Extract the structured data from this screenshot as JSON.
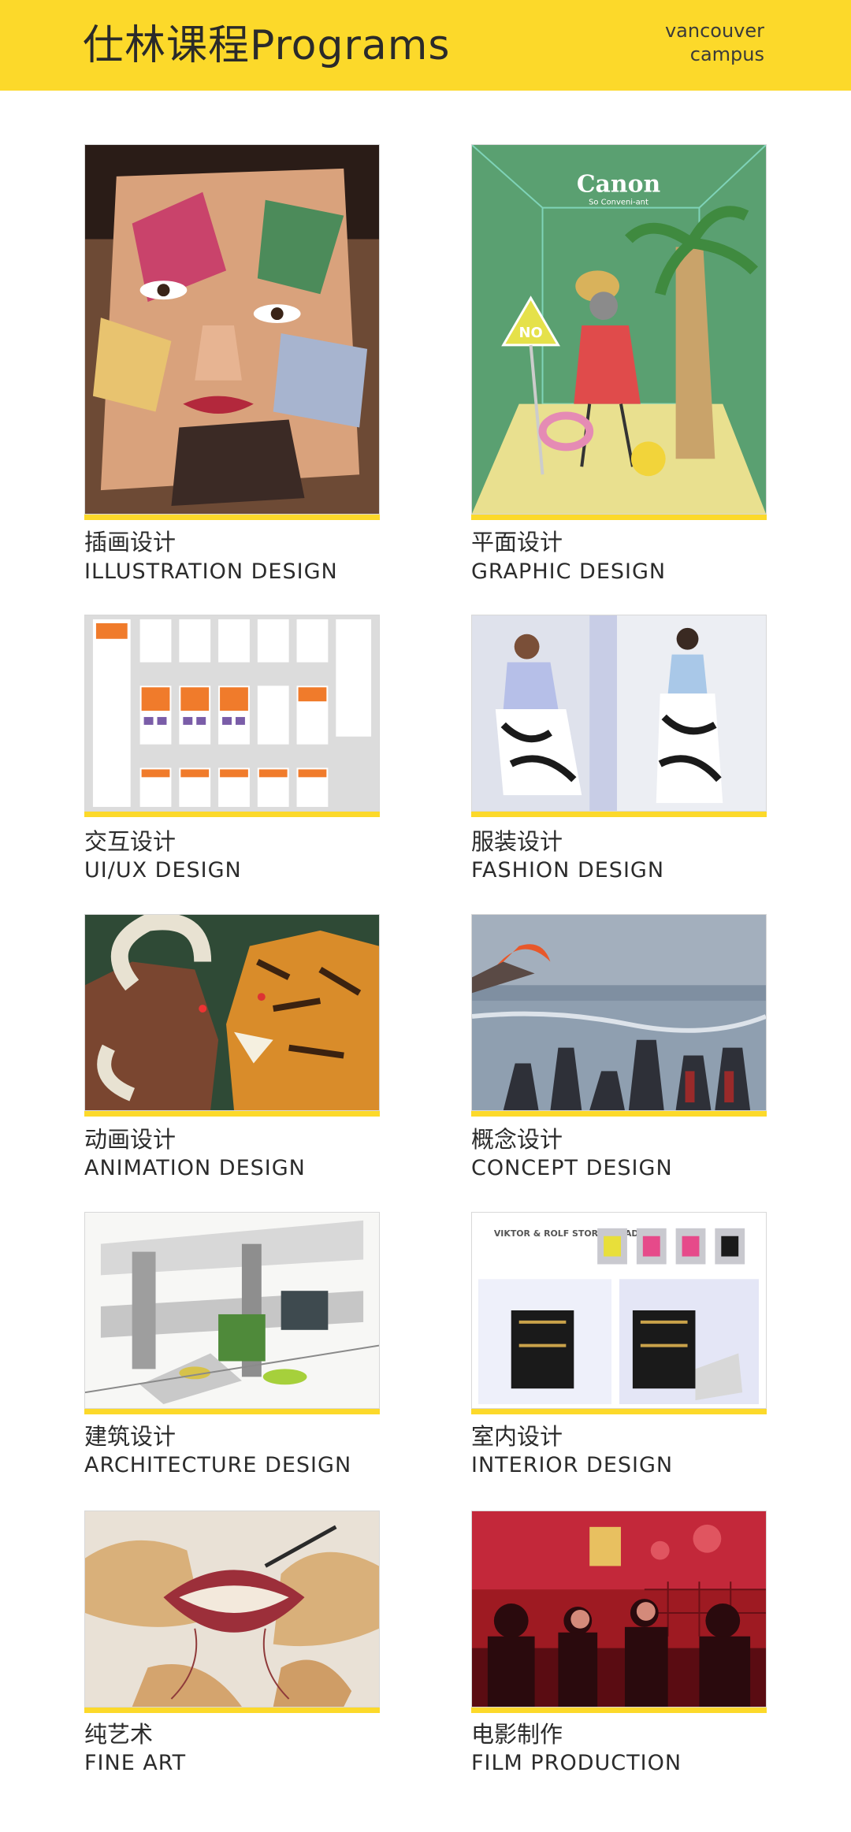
{
  "header": {
    "title": "仕林课程Programs",
    "campus_line1": "vancouver",
    "campus_line2": "campus",
    "accent_color": "#fcd92a"
  },
  "programs": [
    {
      "cn": "插画设计",
      "en": "ILLUSTRATION DESIGN",
      "image": "collage portrait of a face"
    },
    {
      "cn": "平面设计",
      "en": "GRAPHIC DESIGN",
      "image": "Canon poster illustration"
    },
    {
      "cn": "交互设计",
      "en": "UI/UX DESIGN",
      "image": "app wireframe flow"
    },
    {
      "cn": "服装设计",
      "en": "FASHION DESIGN",
      "image": "fashion model photos"
    },
    {
      "cn": "动画设计",
      "en": "ANIMATION DESIGN",
      "image": "ram and tiger illustration"
    },
    {
      "cn": "概念设计",
      "en": "CONCEPT DESIGN",
      "image": "snowy battlefield concept art"
    },
    {
      "cn": "建筑设计",
      "en": "ARCHITECTURE DESIGN",
      "image": "interior architecture sketch"
    },
    {
      "cn": "室内设计",
      "en": "INTERIOR DESIGN",
      "image": "store facade models"
    },
    {
      "cn": "纯艺术",
      "en": "FINE ART",
      "image": "hands and mouth painting"
    },
    {
      "cn": "电影制作",
      "en": "FILM PRODUCTION",
      "image": "red film still"
    }
  ],
  "poster_text": {
    "canon_logo": "Canon",
    "canon_tagline": "So Conveni-ant",
    "sign_text": "NO",
    "facade_title": "VIKTOR & ROLF STORE FACADE"
  }
}
